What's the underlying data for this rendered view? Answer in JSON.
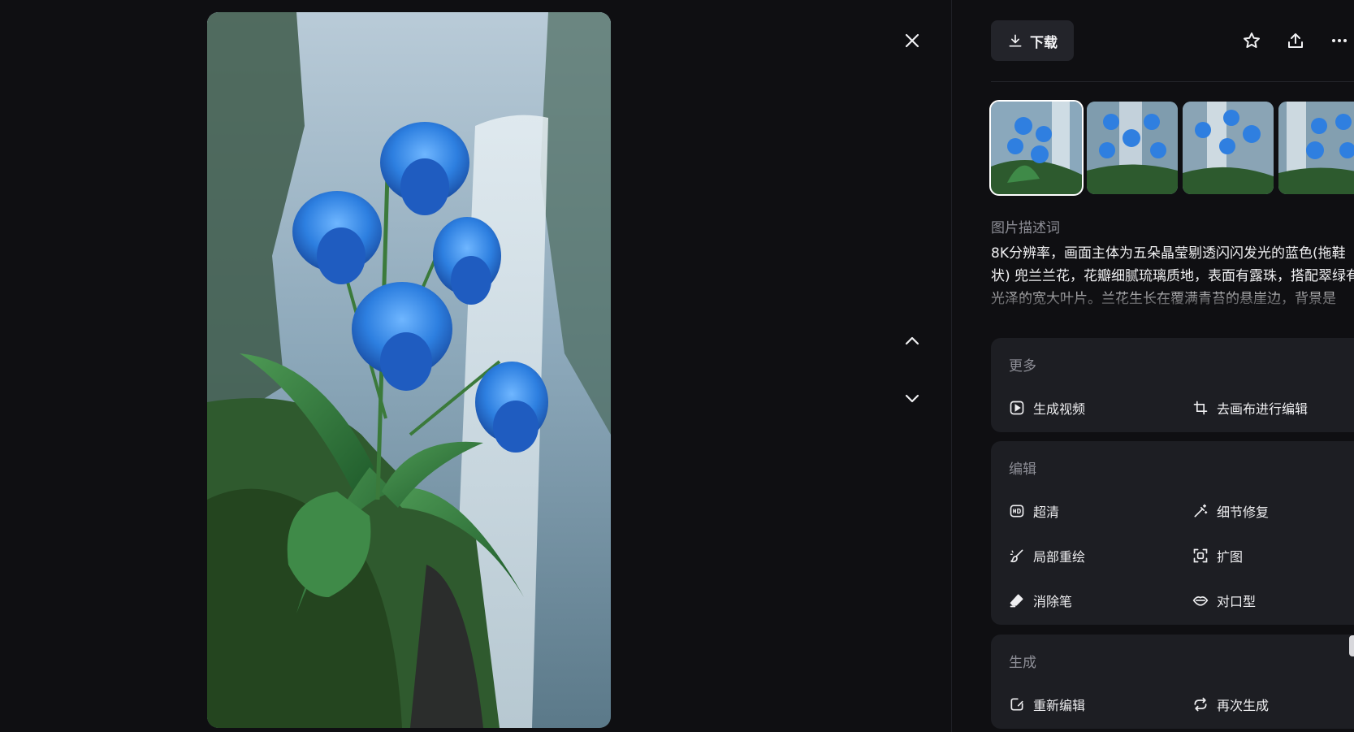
{
  "viewer": {
    "close_icon": "close-icon",
    "prev_icon": "chevron-up-icon",
    "next_icon": "chevron-down-icon"
  },
  "toolbar": {
    "download_label": "下载",
    "icons": [
      "star-icon",
      "share-icon",
      "more-icon"
    ]
  },
  "thumbnails": [
    {
      "selected": true
    },
    {
      "selected": false
    },
    {
      "selected": false
    },
    {
      "selected": false
    }
  ],
  "description": {
    "title": "图片描述词",
    "text": "8K分辨率，画面主体为五朵晶莹剔透闪闪发光的蓝色(拖鞋状) 兜兰兰花，花瓣细腻琉璃质地，表面有露珠，搭配翠绿有光泽的宽大叶片。兰花生长在覆满青苔的悬崖边，背景是"
  },
  "sections": {
    "more": {
      "title": "更多",
      "actions": [
        {
          "label": "生成视频",
          "icon": "play-video-icon"
        },
        {
          "label": "去画布进行编辑",
          "icon": "crop-canvas-icon"
        }
      ]
    },
    "edit": {
      "title": "编辑",
      "actions": [
        {
          "label": "超清",
          "icon": "hd-icon"
        },
        {
          "label": "细节修复",
          "icon": "magic-wand-icon"
        },
        {
          "label": "局部重绘",
          "icon": "brush-icon"
        },
        {
          "label": "扩图",
          "icon": "expand-icon"
        },
        {
          "label": "消除笔",
          "icon": "eraser-icon"
        },
        {
          "label": "对口型",
          "icon": "lips-icon"
        }
      ]
    },
    "generate": {
      "title": "生成",
      "actions": [
        {
          "label": "重新编辑",
          "icon": "edit-icon"
        },
        {
          "label": "再次生成",
          "icon": "regenerate-icon"
        }
      ]
    }
  },
  "colors": {
    "background": "#0f0f12",
    "card": "#1d1e23",
    "muted_text": "#8d8e96"
  }
}
